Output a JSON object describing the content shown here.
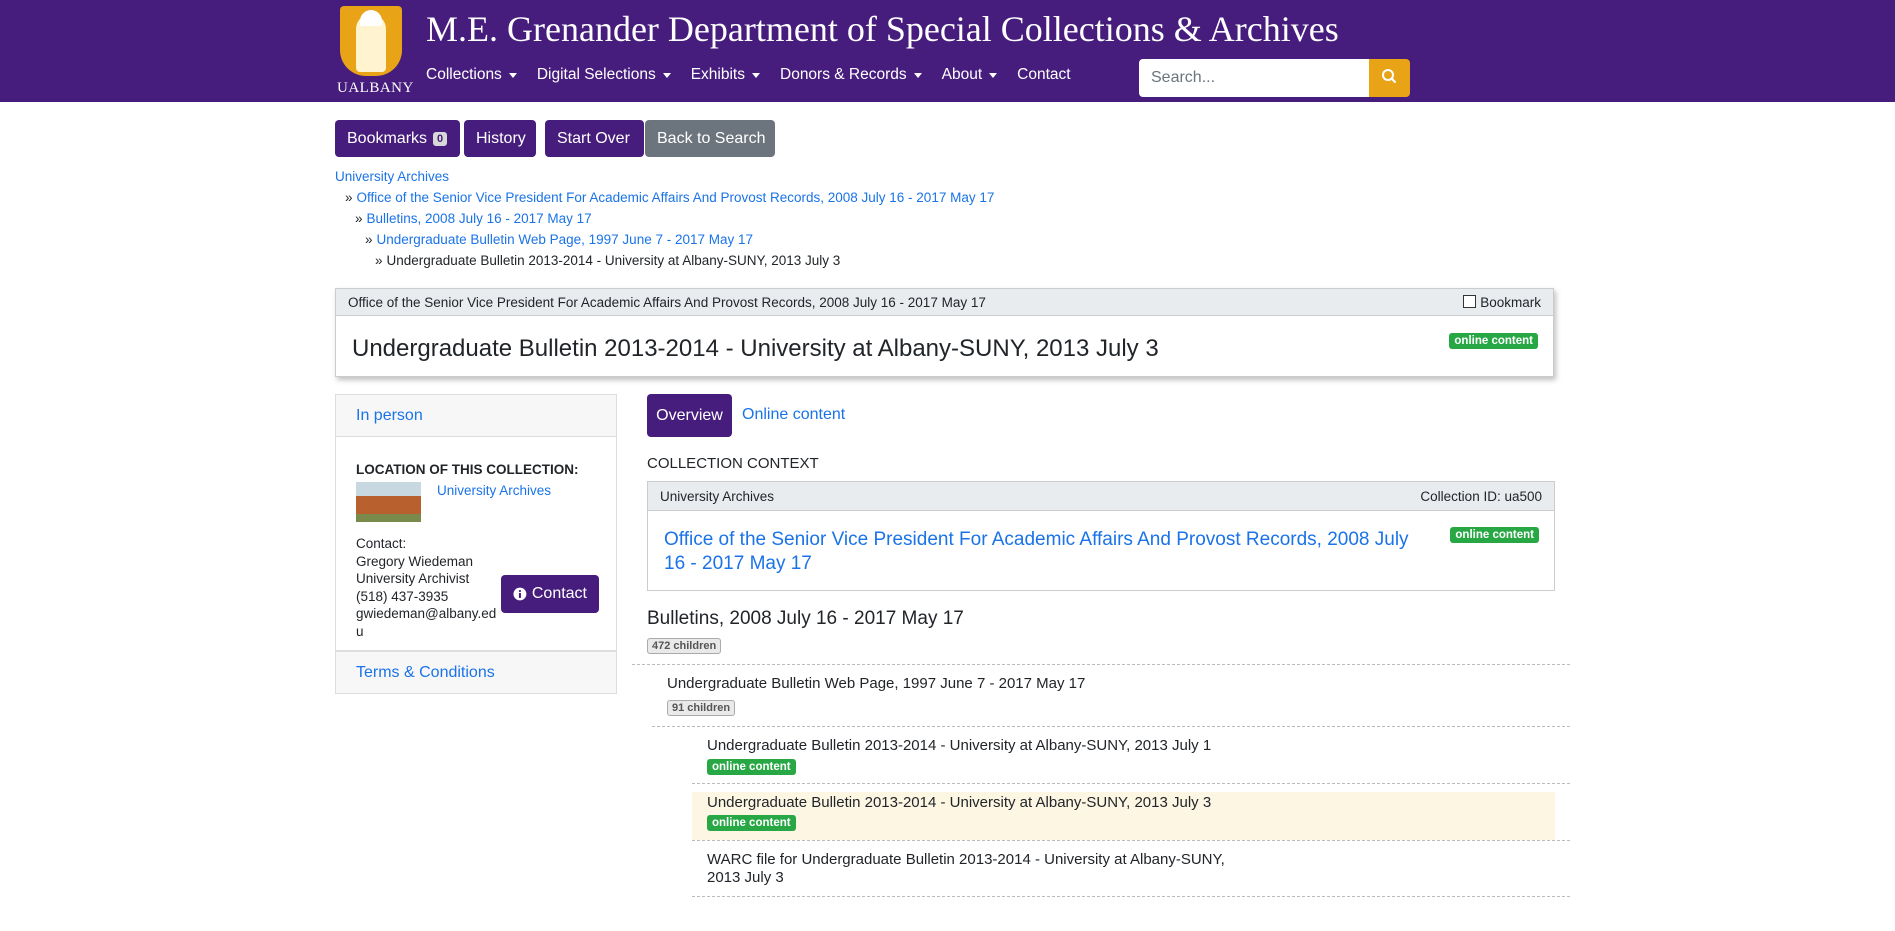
{
  "header": {
    "logo_text": "UALBANY",
    "site_title": "M.E. Grenander Department of Special Collections & Archives",
    "nav": [
      {
        "label": "Collections",
        "dropdown": true
      },
      {
        "label": "Digital Selections",
        "dropdown": true
      },
      {
        "label": "Exhibits",
        "dropdown": true
      },
      {
        "label": "Donors & Records",
        "dropdown": true
      },
      {
        "label": "About",
        "dropdown": true
      },
      {
        "label": "Contact",
        "dropdown": false
      }
    ],
    "search_placeholder": "Search...",
    "search_icon": "search-icon",
    "colors": {
      "brand": "#461d7c",
      "accent": "#e8a317"
    }
  },
  "toolbar": {
    "bookmarks_label": "Bookmarks",
    "bookmarks_count": "0",
    "history_label": "History",
    "start_over_label": "Start Over",
    "back_label": "Back to Search"
  },
  "breadcrumb": {
    "sep": "»",
    "items": [
      "University Archives",
      "Office of the Senior Vice President For Academic Affairs And Provost Records, 2008 July 16 - 2017 May 17",
      "Bulletins, 2008 July 16 - 2017 May 17",
      "Undergraduate Bulletin Web Page, 1997 June 7 - 2017 May 17",
      "Undergraduate Bulletin 2013-2014 - University at Albany-SUNY, 2013 July 3"
    ]
  },
  "record": {
    "parent": "Office of the Senior Vice President For Academic Affairs And Provost Records, 2008 July 16 - 2017 May 17",
    "bookmark_label": "Bookmark",
    "title": "Undergraduate Bulletin 2013-2014 - University at Albany-SUNY, 2013 July 3",
    "badge": "online content"
  },
  "sidebar": {
    "in_person": "In person",
    "location_heading": "LOCATION OF THIS COLLECTION:",
    "location_link": "University Archives",
    "contact_lines": [
      "Contact:",
      "Gregory Wiedeman",
      "University Archivist",
      "(518) 437-3935",
      "gwiedeman@albany.ed",
      "u"
    ],
    "contact_button": "Contact",
    "terms": "Terms & Conditions"
  },
  "tabs": {
    "overview": "Overview",
    "online": "Online content"
  },
  "context": {
    "heading": "COLLECTION CONTEXT",
    "repo": "University Archives",
    "collection_id": "Collection ID: ua500",
    "collection_title": "Office of the Senior Vice President For Academic Affairs And Provost Records, 2008 July 16 - 2017 May 17",
    "badge": "online content"
  },
  "tree": {
    "series_title": "Bulletins, 2008 July 16 - 2017 May 17",
    "series_children": "472 children",
    "sub_title": "Undergraduate Bulletin Web Page, 1997 June 7 - 2017 May 17",
    "sub_children": "91 children",
    "items": [
      {
        "title": "Undergraduate Bulletin 2013-2014 - University at Albany-SUNY, 2013 July 1",
        "badge": "online content"
      },
      {
        "title": "Undergraduate Bulletin 2013-2014 - University at Albany-SUNY, 2013 July 3",
        "badge": "online content"
      },
      {
        "title_line1": "WARC file for Undergraduate Bulletin 2013-2014 - University at Albany-SUNY,",
        "title_line2": "2013 July 3"
      }
    ]
  }
}
